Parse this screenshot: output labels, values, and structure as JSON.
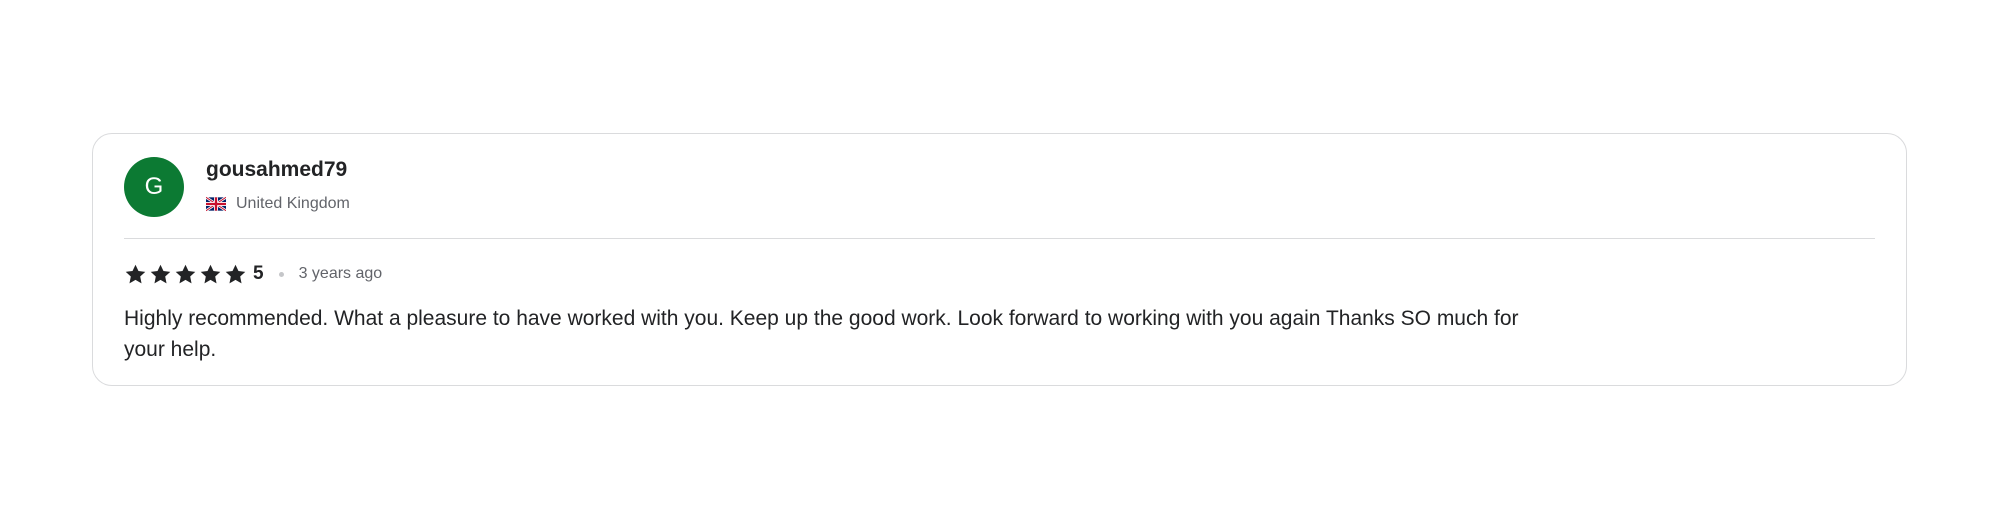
{
  "review": {
    "avatar_letter": "G",
    "avatar_color": "#0c7a33",
    "username": "gousahmed79",
    "country": "United Kingdom",
    "country_flag_icon": "uk-flag-icon",
    "rating": "5",
    "stars_filled": 5,
    "stars_total": 5,
    "star_icon": "star-icon",
    "time_ago": "3 years ago",
    "text": "Highly recommended. What a pleasure to have worked with you. Keep up the good work. Look forward to working with you again Thanks SO much for your help."
  }
}
